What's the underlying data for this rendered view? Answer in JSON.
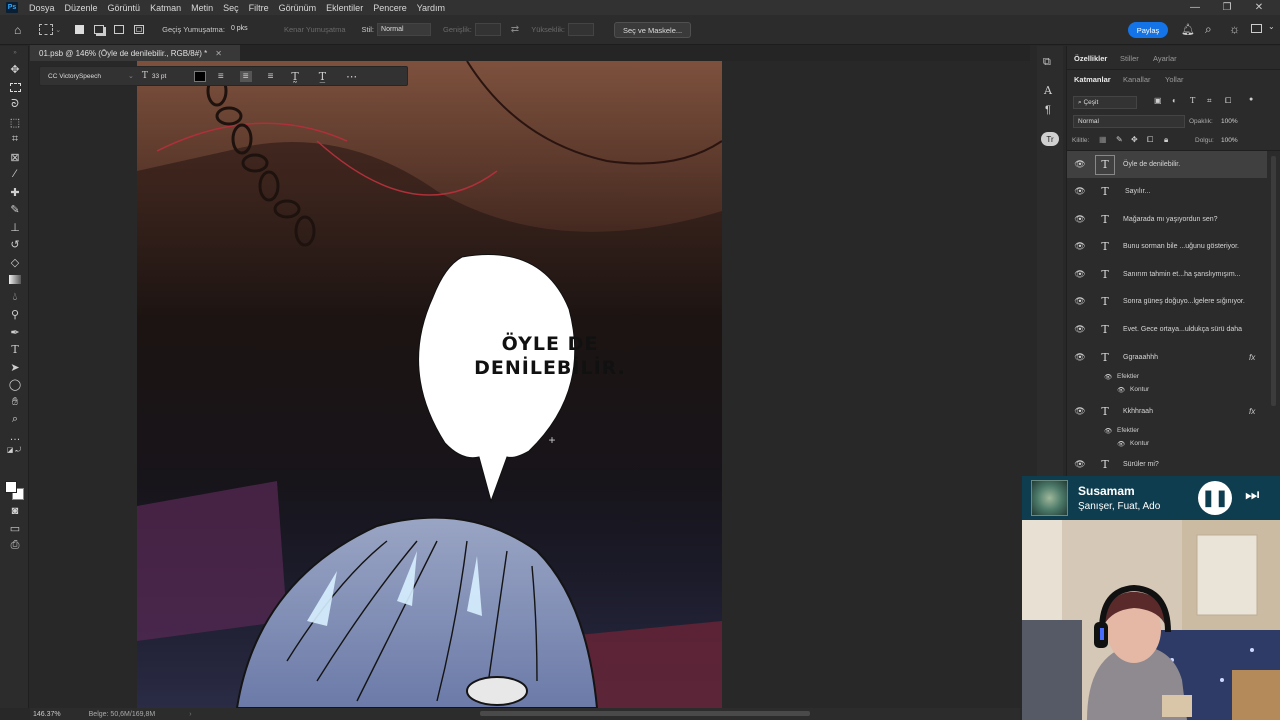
{
  "menu": [
    "Dosya",
    "Düzenle",
    "Görüntü",
    "Katman",
    "Metin",
    "Seç",
    "Filtre",
    "Görünüm",
    "Eklentiler",
    "Pencere",
    "Yardım"
  ],
  "options_bar": {
    "feather_label": "Geçiş Yumuşatma:",
    "feather_value": "0 pks",
    "antialias_label": "Kenar Yumuşatma",
    "style_label": "Stil:",
    "style_value": "Normal",
    "width_label": "Genişlik:",
    "height_label": "Yükseklik:",
    "select_mask_button": "Seç ve Maskele...",
    "share_button": "Paylaş"
  },
  "document_tab": {
    "title": "01.psb @ 146% (Öyle de denilebilir., RGB/8#) *"
  },
  "text_options": {
    "font": "CC VictorySpeech",
    "size": "33 pt",
    "color": "#000000"
  },
  "bubble_text": [
    "ÖYLE DE",
    "DENİLEBİLİR."
  ],
  "properties_tabs": [
    "Özellikler",
    "Stiller",
    "Ayarlar"
  ],
  "layers_tabs": [
    "Katmanlar",
    "Kanallar",
    "Yollar"
  ],
  "layers_panel": {
    "filter_label": "Çeşit",
    "blend_mode": "Normal",
    "opacity_label": "Opaklık:",
    "opacity_value": "100%",
    "lock_label": "Kilitle:",
    "fill_label": "Dolgu:",
    "fill_value": "100%"
  },
  "layers": [
    {
      "name": "Öyle de denilebilir.",
      "selected": true
    },
    {
      "name": "Sayılır...",
      "selected": false
    },
    {
      "name": "Mağarada mı yaşıyordun sen?",
      "selected": false
    },
    {
      "name": "Bunu sorman bile ...uğunu gösteriyor.",
      "selected": false
    },
    {
      "name": "Sanırım tahmin et...ha  şanslıymışım...",
      "selected": false
    },
    {
      "name": "Sonra güneş doğuyo...lgelere sığınıyor.",
      "selected": false
    },
    {
      "name": "Evet. Gece ortaya...uldukça sürü daha",
      "selected": false
    },
    {
      "name": "Ggraaahhh",
      "selected": false,
      "effects": [
        "Efektler",
        "Kontur"
      ]
    },
    {
      "name": "Kkhhraah",
      "selected": false,
      "effects": [
        "Efektler",
        "Kontur"
      ]
    },
    {
      "name": "Sürüler mi?",
      "selected": false
    }
  ],
  "status_bar": {
    "zoom": "146.37%",
    "doc_size": "Belge: 50,6M/169,8M"
  },
  "music_widget": {
    "title": "Susamam",
    "artist": "Şanışer, Fuat, Ado"
  },
  "colors": {
    "accent": "#1473e6",
    "panel_bg": "#2b2b2b",
    "music_bg": "#0e3d4f"
  }
}
